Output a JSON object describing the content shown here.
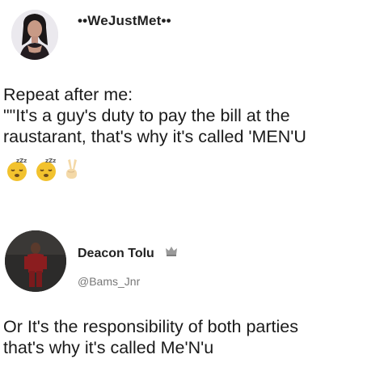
{
  "post1": {
    "username": "••WeJustMet••",
    "lines": [
      "Repeat after me:",
      "\"\"It's a guy's duty to pay the bill at the",
      "raustarant, that's why it's called 'MEN'U"
    ],
    "emojis": [
      "sleeping-face-emoji",
      "sleeping-face-emoji",
      "victory-hand-emoji"
    ]
  },
  "post2": {
    "username": "Deacon Tolu",
    "handle": "@Bams_Jnr",
    "lines": [
      "Or It's the responsibility of both parties",
      "that's why it's called Me'N'u"
    ]
  },
  "colors": {
    "background": "#ffffff",
    "text": "#1a1a1a",
    "handle": "#777777",
    "emoji_yellow": "#f2c22e"
  }
}
